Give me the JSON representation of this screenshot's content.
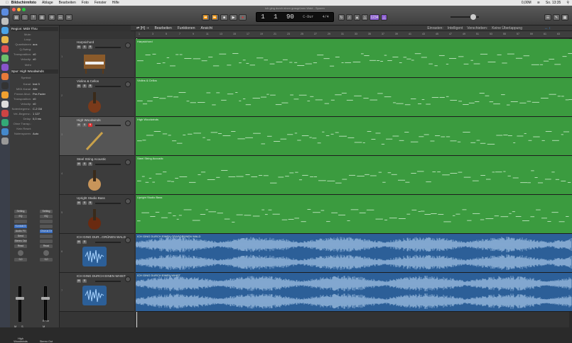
{
  "menubar": {
    "app": "Bildschirmfoto",
    "items": [
      "Ablage",
      "Bearbeiten",
      "Foto",
      "Fenster",
      "Hilfe"
    ],
    "status_cpu": "0,00M",
    "clock": "So. 13:35"
  },
  "toolbar": {
    "doc_title": "ich ging durch einen grasgrünen Wald - Spuren",
    "lcd_bar": "1",
    "lcd_beat": "1",
    "lcd_tempo": "90",
    "lcd_key": "C-Dur",
    "lcd_signature": "4/4",
    "count_badge": "1234"
  },
  "tracks_bar": {
    "menus": [
      "Bearbeiten",
      "Funktionen",
      "Ansicht"
    ],
    "snap_label": "Einrasten:",
    "snap_value": "Intelligent",
    "drag_label": "Verschieben:",
    "drag_value": "Keine Überlappung"
  },
  "inspector": {
    "region_header": "Region: MIDI Thru",
    "region_rows": [
      {
        "k": "Mute:",
        "v": ""
      },
      {
        "k": "Loop:",
        "v": ""
      },
      {
        "k": "Quantisieren",
        "v": "aus"
      },
      {
        "k": "Q-Swing:",
        "v": ""
      },
      {
        "k": "Transposition:",
        "v": "±0"
      },
      {
        "k": "Velocity:",
        "v": "±0"
      }
    ],
    "more_label": "Mehr",
    "track_header": "Spur: High Woodwinds",
    "track_rows": [
      {
        "k": "Symbol:",
        "v": ""
      },
      {
        "k": "Kanal:",
        "v": "Inst 3"
      },
      {
        "k": "MIDI-Kanal:",
        "v": "Alle"
      },
      {
        "k": "Freeze-Mod.:",
        "v": "Pre-Fader"
      },
      {
        "k": "Transposition:",
        "v": "±0"
      },
      {
        "k": "Velocity:",
        "v": "±0"
      },
      {
        "k": "Notenbegrenz.:",
        "v": "C-2  G8"
      },
      {
        "k": "Vel.-Begrenz.:",
        "v": "1  127"
      },
      {
        "k": "Delay:",
        "v": "0,0 ms"
      },
      {
        "k": "Ohne Transp.:",
        "v": ""
      },
      {
        "k": "Kein Reset:",
        "v": ""
      },
      {
        "k": "Notenspuren:",
        "v": "Auto"
      }
    ],
    "strips": [
      {
        "name": "High Woodwinds",
        "buttons": [
          "Setting",
          "EQ",
          "",
          "Kontakt 5",
          "Audio FX",
          "Send",
          "Stereo Out",
          "Read"
        ],
        "vol": "0,0"
      },
      {
        "name": "Stereo Out",
        "buttons": [
          "Setting",
          "EQ",
          "",
          "",
          "Chorus Dr",
          "",
          "",
          "Read"
        ],
        "vol": "0,0"
      }
    ],
    "strip_bottom": [
      "M",
      "S",
      "Bnce",
      "M"
    ]
  },
  "tracks": [
    {
      "num": "1",
      "name": "Harpsichord",
      "kind": "midi",
      "icon": "harpsichord-icon",
      "region": "Harpsichord"
    },
    {
      "num": "2",
      "name": "Violins & Cellos",
      "kind": "midi",
      "icon": "violin-icon",
      "region": "Violins & Cellos"
    },
    {
      "num": "3",
      "name": "High Woodwinds",
      "kind": "midi",
      "icon": "flute-icon",
      "region": "High Woodwinds"
    },
    {
      "num": "4",
      "name": "Steel String Acoustic",
      "kind": "midi",
      "icon": "guitar-icon",
      "region": "Steel String Acoustic"
    },
    {
      "num": "5",
      "name": "Upright Studio Bass",
      "kind": "midi",
      "icon": "double-bass-icon",
      "region": "Upright Studio Bass"
    },
    {
      "num": "6",
      "name": "ICH GING DUR...GRÜNEN WALD",
      "kind": "audio",
      "icon": "waveform-icon",
      "region": "ICH GING DURCH EINEN GRASGRÜNEN WALD"
    },
    {
      "num": "7",
      "name": "ICH GING DURCH EINEN WHIST",
      "kind": "audio",
      "icon": "waveform-icon",
      "region": "ICH GING DURCH EINEN WHIST"
    }
  ],
  "ruler": [
    "1",
    "3",
    "5",
    "7",
    "9",
    "11",
    "13",
    "15",
    "17",
    "19",
    "21",
    "23",
    "25",
    "27",
    "29",
    "31",
    "33",
    "35",
    "37",
    "39",
    "41",
    "43",
    "45",
    "47",
    "49",
    "51",
    "53",
    "55",
    "57",
    "59",
    "61",
    "63"
  ],
  "colors": {
    "midi": "#3b9b3f",
    "audio": "#2c5f98",
    "record": "#e03030",
    "accent": "#8a5cd0"
  }
}
